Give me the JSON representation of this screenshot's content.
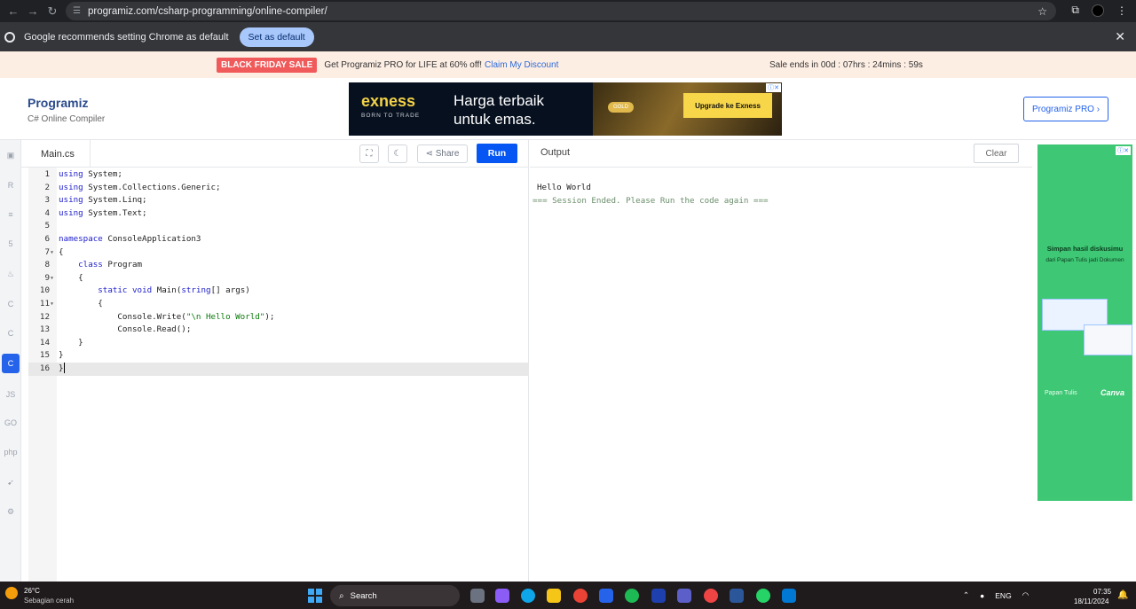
{
  "browser": {
    "url": "programiz.com/csharp-programming/online-compiler/",
    "infobar_message": "Google recommends setting Chrome as default",
    "infobar_button": "Set as default"
  },
  "promo": {
    "badge": "BLACK FRIDAY SALE",
    "offer": "Get Programiz PRO for LIFE at 60% off!",
    "claim_link": "Claim My Discount",
    "countdown": "Sale ends in 00d : 07hrs : 24mins : 59s"
  },
  "header": {
    "logo_text": "Programiz",
    "logo_subtitle": "C# Online Compiler",
    "pro_button": "Programiz PRO ›"
  },
  "top_ad": {
    "brand": "exness",
    "tagline": "BORN TO TRADE",
    "headline": "Harga terbaik untuk emas.",
    "badge": "GOLD",
    "cta": "Upgrade ke Exness"
  },
  "editor": {
    "file_tab": "Main.cs",
    "share_label": "Share",
    "run_label": "Run",
    "lines": [
      {
        "n": "1",
        "fold": "",
        "html": "<span class=\"kw\">using</span> System;"
      },
      {
        "n": "2",
        "fold": "",
        "html": "<span class=\"kw\">using</span> System.Collections.Generic;"
      },
      {
        "n": "3",
        "fold": "",
        "html": "<span class=\"kw\">using</span> System.Linq;"
      },
      {
        "n": "4",
        "fold": "",
        "html": "<span class=\"kw\">using</span> System.Text;"
      },
      {
        "n": "5",
        "fold": "",
        "html": ""
      },
      {
        "n": "6",
        "fold": "",
        "html": "<span class=\"kw\">namespace</span> ConsoleApplication3"
      },
      {
        "n": "7",
        "fold": "▼",
        "html": "{"
      },
      {
        "n": "8",
        "fold": "",
        "html": "    <span class=\"kw\">class</span> Program"
      },
      {
        "n": "9",
        "fold": "▼",
        "html": "    {"
      },
      {
        "n": "10",
        "fold": "",
        "html": "        <span class=\"kw\">static</span> <span class=\"kw\">void</span> Main(<span class=\"kw\">string</span>[] args)"
      },
      {
        "n": "11",
        "fold": "▼",
        "html": "        {"
      },
      {
        "n": "12",
        "fold": "",
        "html": "            Console.Write(<span class=\"str\">\"\\n Hello World\"</span>);"
      },
      {
        "n": "13",
        "fold": "",
        "html": "            Console.Read();"
      },
      {
        "n": "14",
        "fold": "",
        "html": "    }"
      },
      {
        "n": "15",
        "fold": "",
        "html": "}"
      },
      {
        "n": "16",
        "fold": "",
        "html": "}<span class=\"caret\"></span>"
      }
    ],
    "current_line": 16
  },
  "output": {
    "title": "Output",
    "clear_label": "Clear",
    "hello": "Hello World",
    "session_ended": "=== Session Ended. Please Run the code again ==="
  },
  "side_ad": {
    "headline": "Simpan hasil diskusimu",
    "subline": "dari Papan Tulis jadi Dokumen",
    "brand_left": "Papan Tulis",
    "brand_right": "Canva"
  },
  "languages": [
    {
      "name": "python",
      "glyph": "▣"
    },
    {
      "name": "r",
      "glyph": "R"
    },
    {
      "name": "sql",
      "glyph": "≡"
    },
    {
      "name": "html",
      "glyph": "5"
    },
    {
      "name": "java",
      "glyph": "♨"
    },
    {
      "name": "c",
      "glyph": "C"
    },
    {
      "name": "cpp",
      "glyph": "C"
    },
    {
      "name": "csharp",
      "glyph": "C",
      "active": true
    },
    {
      "name": "js",
      "glyph": "JS"
    },
    {
      "name": "go",
      "glyph": "GO"
    },
    {
      "name": "php",
      "glyph": "php"
    },
    {
      "name": "swift",
      "glyph": "➹"
    },
    {
      "name": "rust",
      "glyph": "⚙"
    }
  ],
  "taskbar": {
    "temperature": "26°C",
    "weather": "Sebagian cerah",
    "search": "Search",
    "lang": "ENG",
    "time": "07:35",
    "date": "18/11/2024"
  },
  "colors": {
    "run": "#0556f3",
    "keyword": "#1d1dcc",
    "string": "#0a7a0a",
    "sale": "#f05a5a"
  }
}
